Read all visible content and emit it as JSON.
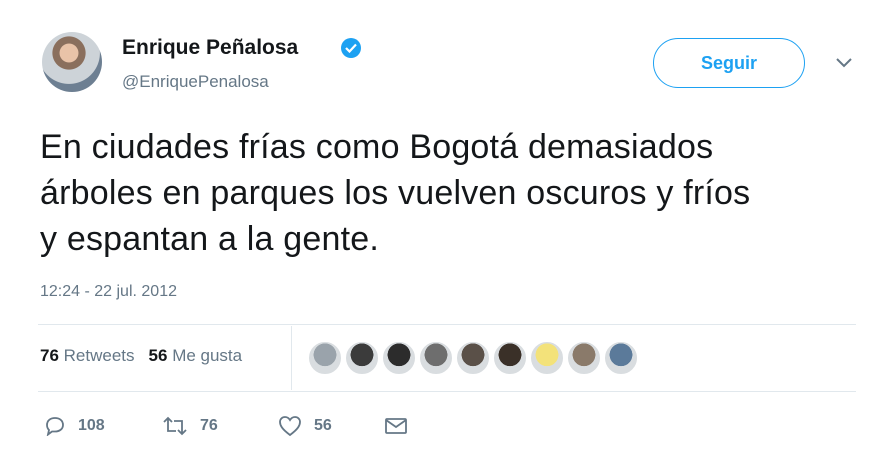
{
  "author": {
    "name": "Enrique Peñalosa",
    "handle": "@EnriquePenalosa",
    "verified": true,
    "verified_icon": "verified-badge-icon",
    "verified_color": "#1da1f2"
  },
  "follow_button": {
    "label": "Seguir",
    "color": "#1da1f2"
  },
  "menu_icon": "chevron-down-icon",
  "tweet": {
    "text": "En ciudades frías como Bogotá demasiados\nárboles en parques los vuelven oscuros y fríos\ny espantan a la gente.",
    "timestamp": "12:24 - 22 jul. 2012"
  },
  "stats": {
    "retweets_count": "76",
    "retweets_label": "Retweets",
    "likes_count": "56",
    "likes_label": "Me gusta"
  },
  "likers": [
    {
      "icon": "user-avatar-icon",
      "color": "#9aa3ab"
    },
    {
      "icon": "user-avatar-icon",
      "color": "#3b3b3b"
    },
    {
      "icon": "user-avatar-icon",
      "color": "#2c2c2c"
    },
    {
      "icon": "user-avatar-icon",
      "color": "#6e6e6e"
    },
    {
      "icon": "user-avatar-icon",
      "color": "#5a5048"
    },
    {
      "icon": "user-avatar-icon",
      "color": "#3a3028"
    },
    {
      "icon": "emoji-avatar-icon",
      "color": "#f3e27a"
    },
    {
      "icon": "user-avatar-icon",
      "color": "#8a7a6a"
    },
    {
      "icon": "user-avatar-icon",
      "color": "#5b7a9a"
    }
  ],
  "actions": {
    "reply_icon": "reply-icon",
    "reply_count": "108",
    "retweet_icon": "retweet-icon",
    "retweet_count": "76",
    "like_icon": "heart-icon",
    "like_count": "56",
    "dm_icon": "envelope-icon"
  }
}
